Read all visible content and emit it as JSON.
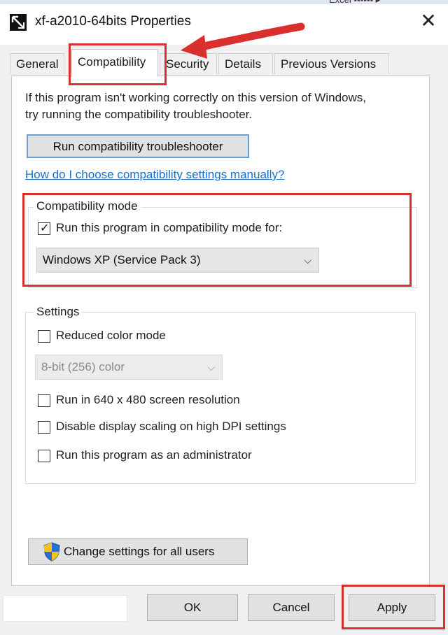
{
  "window": {
    "title": "xf-a2010-64bits Properties",
    "close_glyph": "✕",
    "icon": "app-file-icon",
    "top_partial_text": "Excel ▪▪▪▪▪▪ ▸"
  },
  "tabs": [
    {
      "label": "General",
      "active": false
    },
    {
      "label": "Compatibility",
      "active": true
    },
    {
      "label": "Security",
      "active": false
    },
    {
      "label": "Details",
      "active": false
    },
    {
      "label": "Previous Versions",
      "active": false
    }
  ],
  "compatibility": {
    "intro_line1": "If this program isn't working correctly on this version of Windows,",
    "intro_line2": "try running the compatibility troubleshooter.",
    "troubleshoot_button": "Run compatibility troubleshooter",
    "manual_link": "How do I choose compatibility settings manually?",
    "mode_group_label": "Compatibility mode",
    "mode_checkbox_label": "Run this program in compatibility mode for:",
    "mode_checkbox_checked": true,
    "mode_selected": "Windows XP (Service Pack 3)",
    "settings_group_label": "Settings",
    "settings": {
      "reduced_color_label": "Reduced color mode",
      "reduced_color_checked": false,
      "color_selected": "8-bit (256) color",
      "res_640_label": "Run in 640 x 480 screen resolution",
      "res_640_checked": false,
      "dpi_label": "Disable display scaling on high DPI settings",
      "dpi_checked": false,
      "admin_label": "Run this program as an administrator",
      "admin_checked": false
    },
    "all_users_button": "Change settings for all users"
  },
  "footer": {
    "ok": "OK",
    "cancel": "Cancel",
    "apply": "Apply"
  },
  "colors": {
    "highlight": "#d9302f",
    "link": "#1a6fc9",
    "focus_border": "#6a9fd6"
  }
}
